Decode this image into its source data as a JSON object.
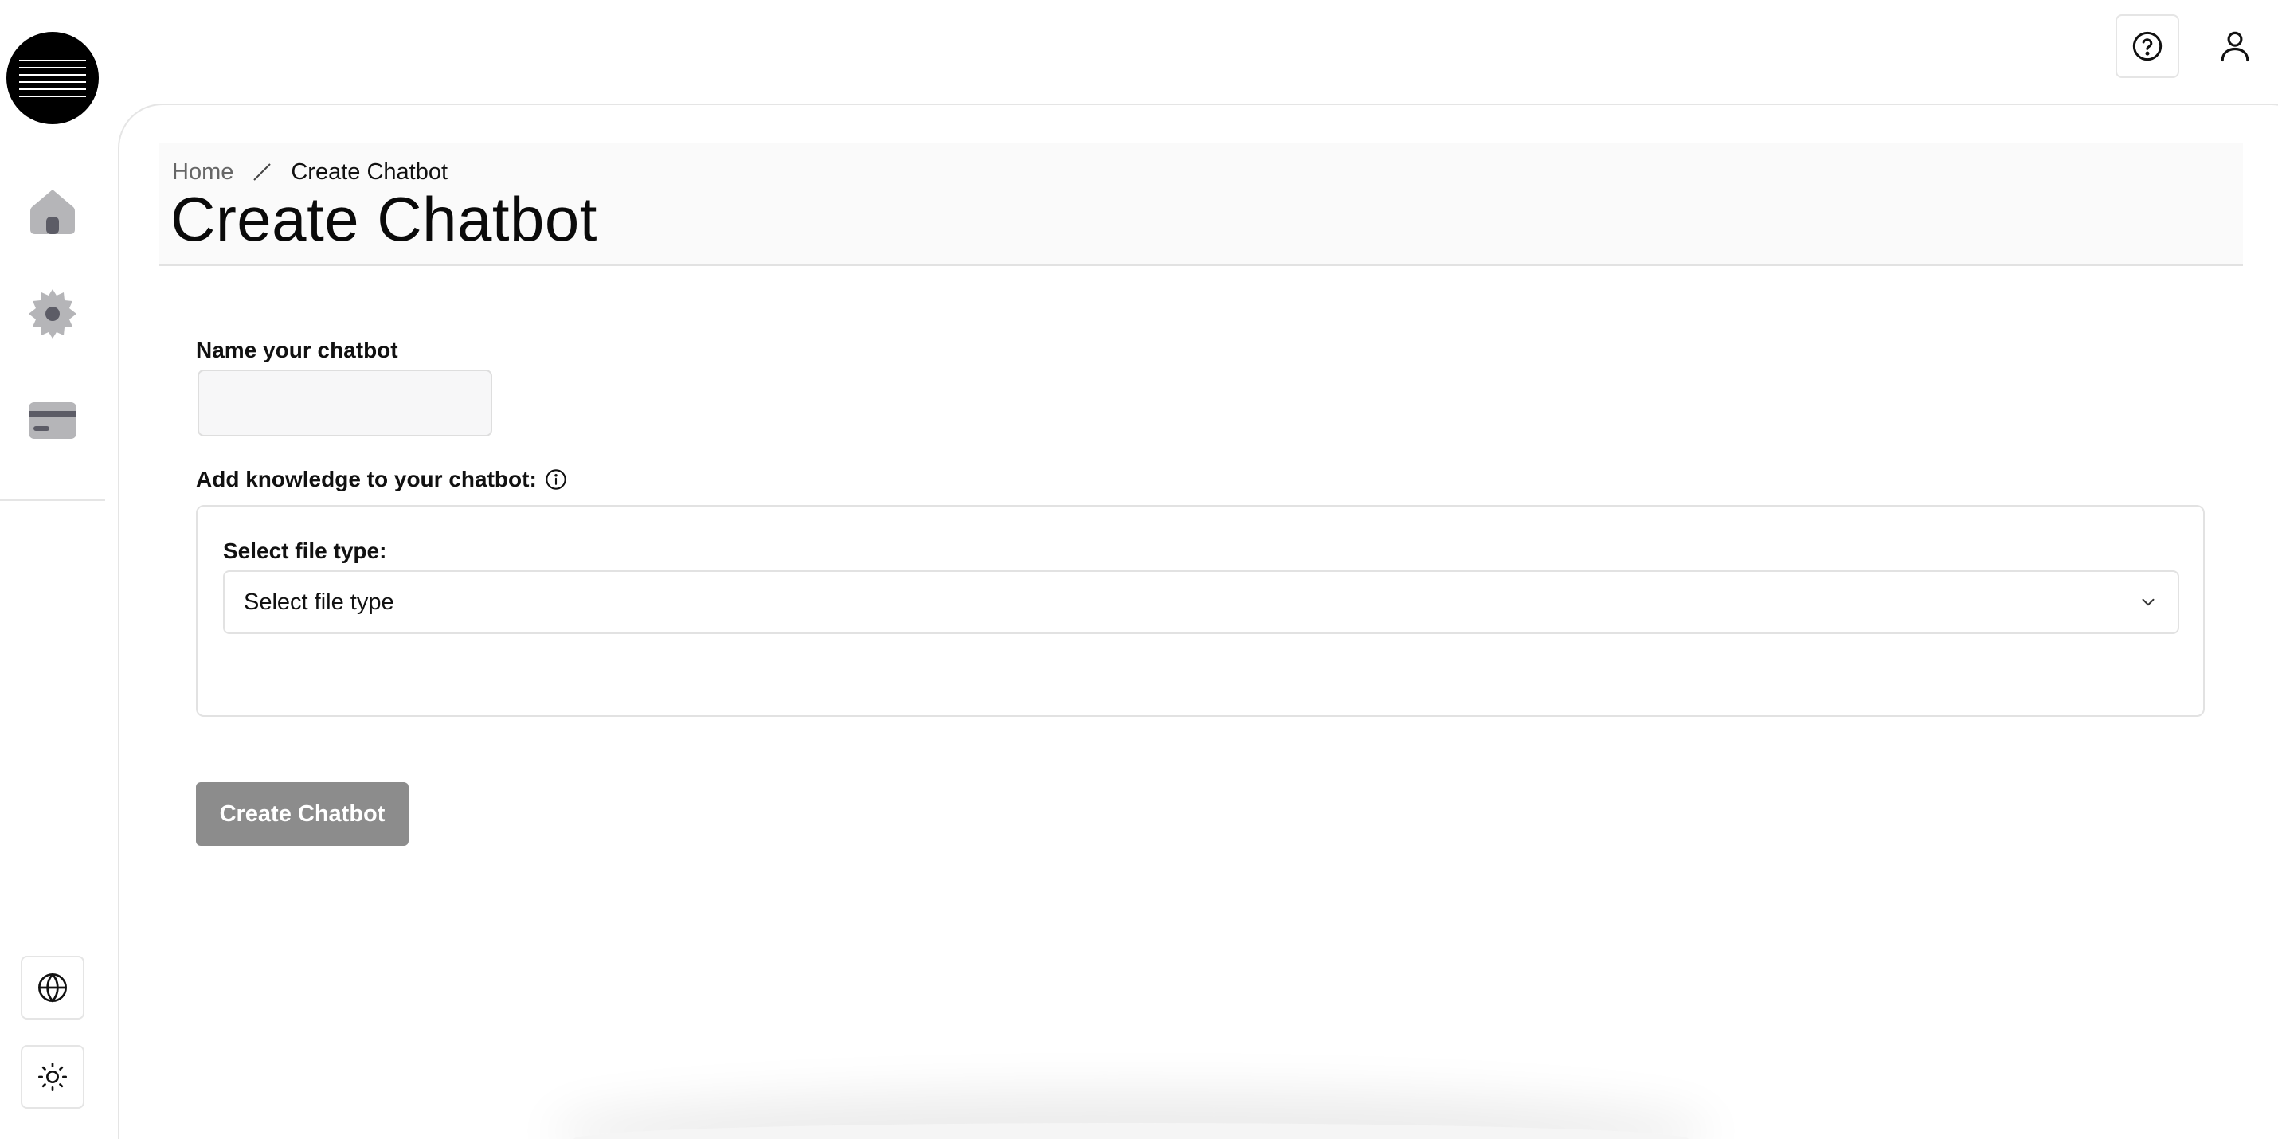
{
  "sidebar": {
    "nav_items": [
      {
        "name": "home",
        "icon": "home-icon"
      },
      {
        "name": "settings",
        "icon": "gear-icon"
      },
      {
        "name": "billing",
        "icon": "credit-card-icon"
      }
    ],
    "utility_items": [
      {
        "name": "language",
        "icon": "globe-icon"
      },
      {
        "name": "theme",
        "icon": "sun-icon"
      }
    ]
  },
  "topbar": {
    "help_icon": "help-circle-icon",
    "user_icon": "user-icon"
  },
  "breadcrumb": {
    "home": "Home",
    "current": "Create Chatbot"
  },
  "page": {
    "title": "Create Chatbot"
  },
  "form": {
    "name_label": "Name your chatbot",
    "name_value": "",
    "knowledge_label": "Add knowledge to your chatbot:",
    "file_type_label": "Select file type:",
    "file_type_selected": "Select file type",
    "submit_label": "Create Chatbot"
  },
  "colors": {
    "accent": "#000000",
    "sidebar_icon": "#b5b5b8",
    "sidebar_icon_dark": "#5c5c66",
    "button_disabled": "#8c8c8c"
  }
}
